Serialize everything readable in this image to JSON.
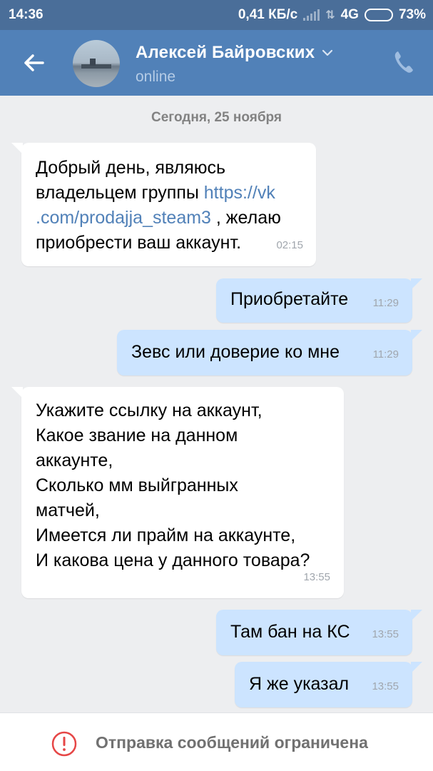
{
  "status_bar": {
    "time": "14:36",
    "speed": "0,41 КБ/с",
    "network": "4G",
    "battery": "73%",
    "battery_level": 0.73
  },
  "header": {
    "name": "Алексей Байровских",
    "status": "online"
  },
  "date_divider": "Сегодня, 25 ноября",
  "messages": [
    {
      "direction": "in",
      "text_before": "Добрый день, являюсь\nвладельцем группы ",
      "link": "https://vk\n.com/prodajja_steam3",
      "text_after": " , желаю\nприобрести ваш аккаунт.",
      "time": "02:15"
    },
    {
      "direction": "out",
      "text": "Приобретайте",
      "time": "11:29"
    },
    {
      "direction": "out",
      "text": "Зевс или доверие ко мне",
      "time": "11:29"
    },
    {
      "direction": "in",
      "text": "Укажите ссылку на аккаунт,\nКакое звание на данном\nаккаунте,\nСколько мм выйгранных\nматчей,\nИмеется ли прайм на аккаунте,\nИ какова цена у данного товара?",
      "time": "13:55"
    },
    {
      "direction": "out",
      "text": "Там бан на КС",
      "time": "13:55"
    },
    {
      "direction": "out",
      "text": "Я же указал",
      "time": "13:55"
    }
  ],
  "footer": {
    "restriction_text": "Отправка сообщений ограничена"
  },
  "colors": {
    "header_bg": "#5181b8",
    "incoming_bubble": "#ffffff",
    "outgoing_bubble": "#cce4ff",
    "warning": "#e64646",
    "link": "#5181b8"
  }
}
